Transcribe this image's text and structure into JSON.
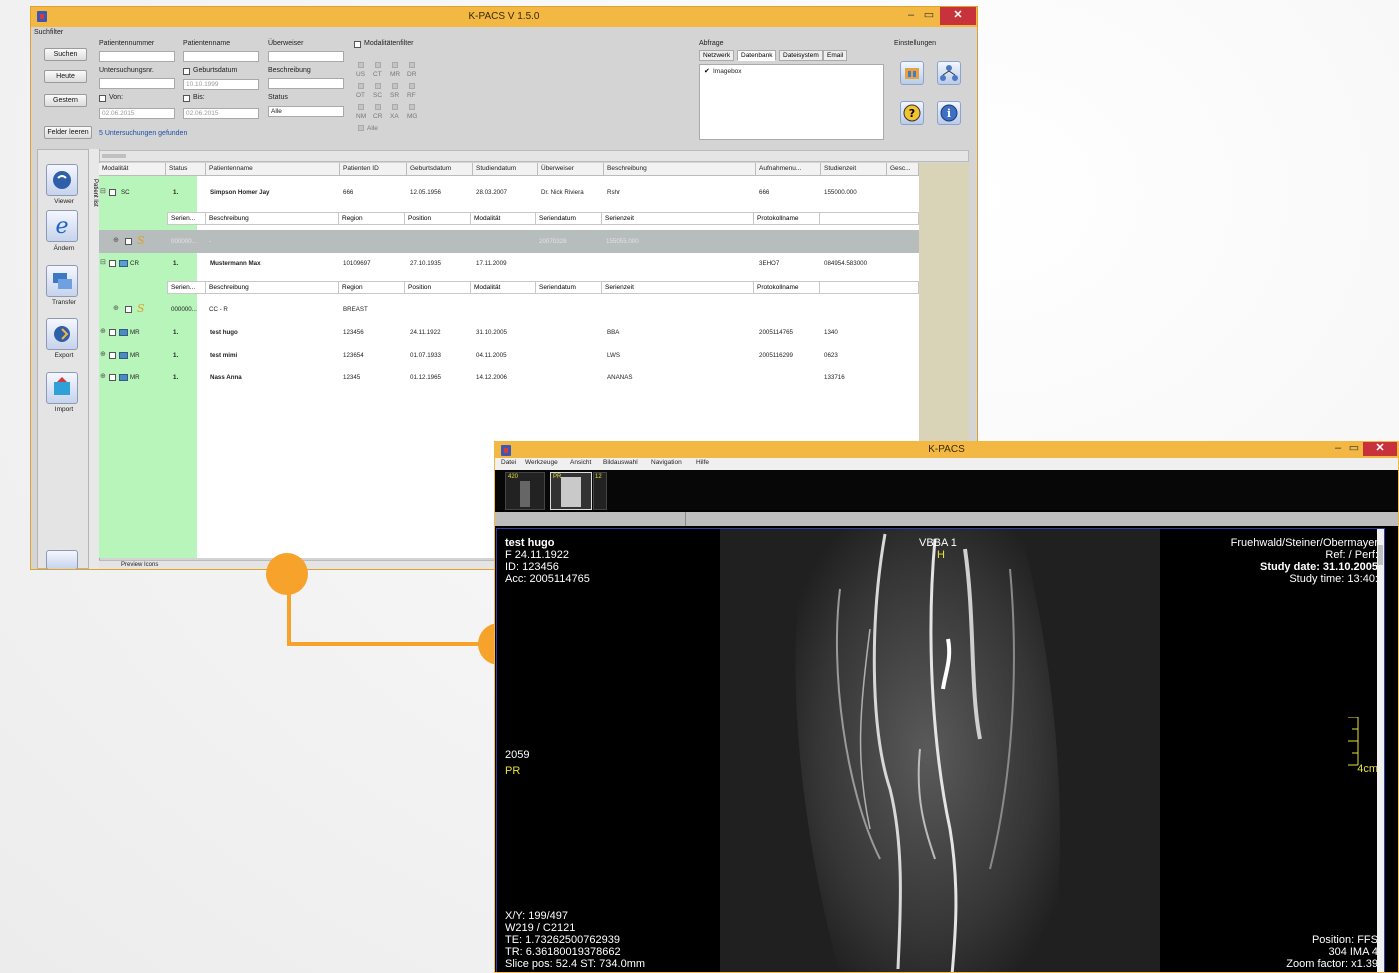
{
  "colors": {
    "accent": "#f2b843",
    "connector": "#f6a22b",
    "green_panel": "#b8f5bb",
    "selected_row": "#b7bcbc"
  },
  "main_window": {
    "title": "K-PACS V 1.5.0",
    "search": {
      "group_label": "Suchfilter",
      "buttons": {
        "search": "Suchen",
        "today": "Heute",
        "yesterday": "Gestern",
        "clear": "Felder leeren"
      },
      "labels": {
        "patient_number": "Patientennummer",
        "patient_name": "Patientenname",
        "referrer": "Überweiser",
        "exam_no": "Untersuchungsnr.",
        "birth_date": "Geburtsdatum",
        "description": "Beschreibung",
        "from": "Von:",
        "to": "Bis:",
        "status": "Status"
      },
      "values": {
        "birth_date": "10.10.1999",
        "from_date": "02.06.2015",
        "to_date": "02.06.2015",
        "status": "Alle"
      },
      "result_text": "5 Untersuchungen gefunden"
    },
    "modality_filter": {
      "label": "Modalitätenfilter",
      "rows": [
        [
          "US",
          "CT",
          "MR",
          "DR"
        ],
        [
          "OT",
          "SC",
          "SR",
          "RF"
        ],
        [
          "NM",
          "CR",
          "XA",
          "MG"
        ]
      ],
      "all_label": "Alle"
    },
    "query": {
      "label": "Abfrage",
      "tabs": [
        "Netzwerk",
        "Datenbank",
        "Dateisystem",
        "Email"
      ],
      "active_tab": "Datenbank",
      "item": "Imagebox"
    },
    "settings": {
      "label": "Einstellungen"
    },
    "sidebar": {
      "items": [
        "Viewer",
        "Ändern",
        "Transfer",
        "Export",
        "Import"
      ],
      "vertical_label": "Patient list"
    },
    "table": {
      "columns": [
        "Modalität",
        "Status",
        "Patientenname",
        "Patienten ID",
        "Geburtsdatum",
        "Studiendatum",
        "Überweiser",
        "Beschreibung",
        "Aufnahmenu...",
        "Studienzeit",
        "Gesc..."
      ],
      "sub_columns": [
        "Serien...",
        "Beschreibung",
        "Region",
        "Position",
        "Modalität",
        "Seriendatum",
        "Serienzeit",
        "Protokollname"
      ],
      "rows": [
        {
          "modality": "SC",
          "status": "1.",
          "name": "Simpson Homer Jay",
          "id": "666",
          "birth": "12.05.1956",
          "study_date": "28.03.2007",
          "referrer": "Dr. Nick Riviera",
          "desc": "Rshr",
          "acc": "666",
          "time": "155000.000"
        },
        {
          "series": "000000...",
          "series_desc": "-",
          "series_date": "20070328",
          "series_time": "155055.000"
        },
        {
          "modality": "CR",
          "status": "1.",
          "name": "Mustermann Max",
          "id": "10109697",
          "birth": "27.10.1935",
          "study_date": "17.11.2009",
          "referrer": "",
          "desc": "",
          "acc": "3EHO7",
          "time": "084954.583000"
        },
        {
          "series": "000000...",
          "series_desc": "CC - R",
          "region": "BREAST"
        },
        {
          "modality": "MR",
          "status": "1.",
          "name": "test hugo",
          "id": "123456",
          "birth": "24.11.1922",
          "study_date": "31.10.2005",
          "referrer": "",
          "desc": "BBA",
          "acc": "2005114765",
          "time": "1340"
        },
        {
          "modality": "MR",
          "status": "1.",
          "name": "test mimi",
          "id": "123654",
          "birth": "01.07.1933",
          "study_date": "04.11.2005",
          "referrer": "",
          "desc": "LWS",
          "acc": "2005116299",
          "time": "0623"
        },
        {
          "modality": "MR",
          "status": "1.",
          "name": "Nass Anna",
          "id": "12345",
          "birth": "01.12.1965",
          "study_date": "14.12.2006",
          "referrer": "",
          "desc": "ANANAS",
          "acc": "",
          "time": "133716"
        }
      ]
    },
    "preview_label": "Preview Icons"
  },
  "viewer_window": {
    "title": "K-PACS",
    "menu": [
      "Datei",
      "Werkzeuge",
      "Ansicht",
      "Bildauswahl",
      "Navigation",
      "Hilfe"
    ],
    "thumbs": [
      "420",
      "PR",
      "12"
    ],
    "overlay": {
      "top_left": [
        "test hugo",
        "F  24.11.1922",
        "ID: 123456",
        "Acc: 2005114765"
      ],
      "top_center": "VBBA 1",
      "orientation_top": "H",
      "top_right": [
        "Fruehwald/Steiner/Obermayer",
        "Ref:  / Perf:",
        "Study date: 31.10.2005",
        "Study time: 13:40:"
      ],
      "left_mid": "2059",
      "orientation_left": "PR",
      "scale_label": "4cm",
      "bottom_left": [
        "X/Y: 199/497",
        "W219 / C2121",
        "TE: 1.73262500762939",
        "TR: 6.36180019378662",
        "Slice pos: 52.4  ST: 734.0mm"
      ],
      "bottom_right": [
        "Position: FFS",
        "304 IMA 4",
        "Zoom factor: x1.39"
      ]
    }
  }
}
